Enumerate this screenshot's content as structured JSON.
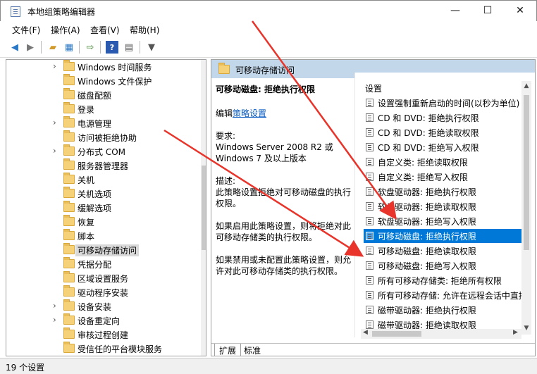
{
  "window": {
    "title": "本地组策略编辑器",
    "minimize": "—",
    "maximize": "☐",
    "close": "✕"
  },
  "menu": [
    "文件(F)",
    "操作(A)",
    "查看(V)",
    "帮助(H)"
  ],
  "toolbar": [
    "back-icon",
    "forward-icon",
    "up-folder-icon",
    "show-hide-tree-icon",
    "export-list-icon",
    "help-icon",
    "properties-icon",
    "filter-icon"
  ],
  "tree": [
    {
      "label": "Windows 时间服务",
      "expandable": true
    },
    {
      "label": "Windows 文件保护",
      "expandable": false
    },
    {
      "label": "磁盘配额",
      "expandable": false
    },
    {
      "label": "登录",
      "expandable": false
    },
    {
      "label": "电源管理",
      "expandable": true
    },
    {
      "label": "访问被拒绝协助",
      "expandable": false
    },
    {
      "label": "分布式 COM",
      "expandable": true
    },
    {
      "label": "服务器管理器",
      "expandable": false
    },
    {
      "label": "关机",
      "expandable": false
    },
    {
      "label": "关机选项",
      "expandable": false
    },
    {
      "label": "缓解选项",
      "expandable": false
    },
    {
      "label": "恢复",
      "expandable": false
    },
    {
      "label": "脚本",
      "expandable": false
    },
    {
      "label": "可移动存储访问",
      "expandable": false,
      "selected": true
    },
    {
      "label": "凭据分配",
      "expandable": false
    },
    {
      "label": "区域设置服务",
      "expandable": false
    },
    {
      "label": "驱动程序安装",
      "expandable": false
    },
    {
      "label": "设备安装",
      "expandable": true
    },
    {
      "label": "设备重定向",
      "expandable": true
    },
    {
      "label": "审核过程创建",
      "expandable": false
    },
    {
      "label": "受信任的平台模块服务",
      "expandable": false
    }
  ],
  "right": {
    "header": "可移动存储访问",
    "desc": {
      "title": "可移动磁盘: 拒绝执行权限",
      "edit_prefix": "编辑",
      "edit_link": "策略设置",
      "req_label": "要求:",
      "req_text": "Windows Server 2008 R2 或 Windows 7 及以上版本",
      "desc_label": "描述:",
      "desc_text": "此策略设置拒绝对可移动磁盘的执行权限。",
      "enable_text": "如果启用此策略设置，则将拒绝对此可移动存储类的执行权限。",
      "disable_text": "如果禁用或未配置此策略设置，则允许对此可移动存储类的执行权限。"
    },
    "list_header": "设置",
    "items": [
      "设置强制重新启动的时间(以秒为单位)",
      "CD 和 DVD: 拒绝执行权限",
      "CD 和 DVD: 拒绝读取权限",
      "CD 和 DVD: 拒绝写入权限",
      "自定义类: 拒绝读取权限",
      "自定义类: 拒绝写入权限",
      "软盘驱动器: 拒绝执行权限",
      "软盘驱动器: 拒绝读取权限",
      "软盘驱动器: 拒绝写入权限",
      "可移动磁盘: 拒绝执行权限",
      "可移动磁盘: 拒绝读取权限",
      "可移动磁盘: 拒绝写入权限",
      "所有可移动存储类: 拒绝所有权限",
      "所有可移动存储: 允许在远程会话中直接",
      "磁带驱动器: 拒绝执行权限",
      "磁带驱动器: 拒绝读取权限"
    ],
    "selected_index": 9,
    "tabs": [
      "扩展",
      "标准"
    ]
  },
  "status": "19 个设置",
  "colors": {
    "selection": "#0078d7",
    "header_bg": "#c3d7ea",
    "arrow": "#e8342a"
  }
}
